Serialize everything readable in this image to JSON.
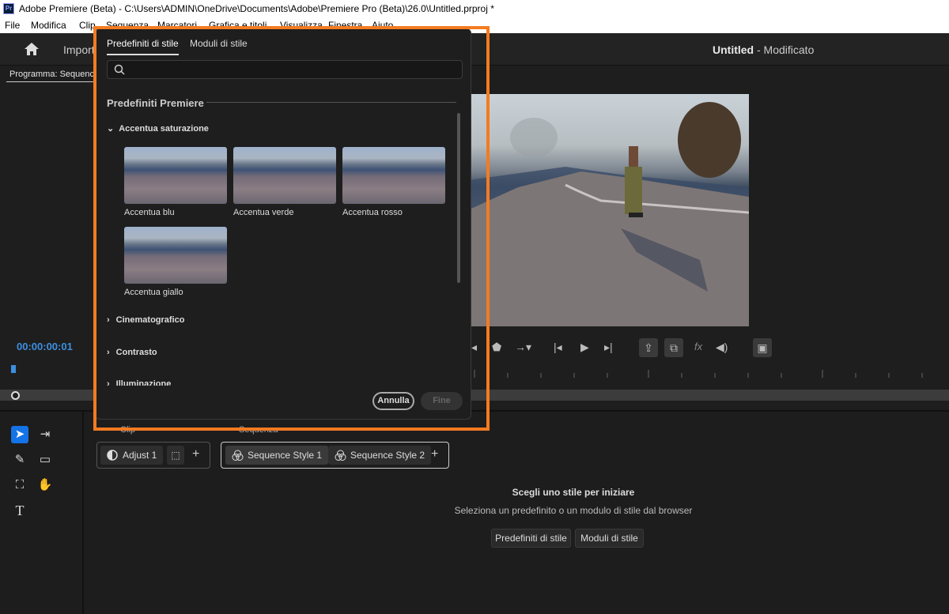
{
  "window": {
    "app_icon": "Pr",
    "title": "Adobe Premiere (Beta) - C:\\Users\\ADMIN\\OneDrive\\Documents\\Adobe\\Premiere Pro (Beta)\\26.0\\Untitled.prproj *"
  },
  "menu": {
    "items": [
      "File",
      "Modifica",
      "Clip",
      "Sequenza",
      "Marcatori",
      "Grafica e titoli",
      "Visualizza",
      "Finestra",
      "Aiuto"
    ]
  },
  "header": {
    "import_label": "Import",
    "project_name": "Untitled",
    "project_status": " - Modificato"
  },
  "monitor": {
    "tab_label": "Programma: Sequenc",
    "timecode": "00:00:00:01",
    "fx_label": "fx"
  },
  "bottom_panel": {
    "clip_tab": "Clip",
    "sequence_tab": "Sequenza",
    "clip_chips": [
      "Adjust 1"
    ],
    "sequence_chips": [
      "Sequence Style 1",
      "Sequence Style 2"
    ],
    "empty_title": "Scegli uno stile per iniziare",
    "empty_subtitle": "Seleziona un predefinito o un modulo di stile dal browser",
    "btn_presets": "Predefiniti di stile",
    "btn_modules": "Moduli di stile"
  },
  "popover": {
    "tabs": [
      "Predefiniti di stile",
      "Moduli di stile"
    ],
    "search_placeholder": "",
    "section_title": "Predefiniti Premiere",
    "expanded_group": "Accentua saturazione",
    "thumbnails": [
      "Accentua blu",
      "Accentua verde",
      "Accentua rosso",
      "Accentua giallo"
    ],
    "collapsed_groups": [
      "Cinematografico",
      "Contrasto",
      "Illuminazione"
    ],
    "cancel_label": "Annulla",
    "done_label": "Fine"
  },
  "colors": {
    "highlight": "#f47b20",
    "accent_blue": "#1473e6",
    "timecode_blue": "#3d8fe0"
  }
}
